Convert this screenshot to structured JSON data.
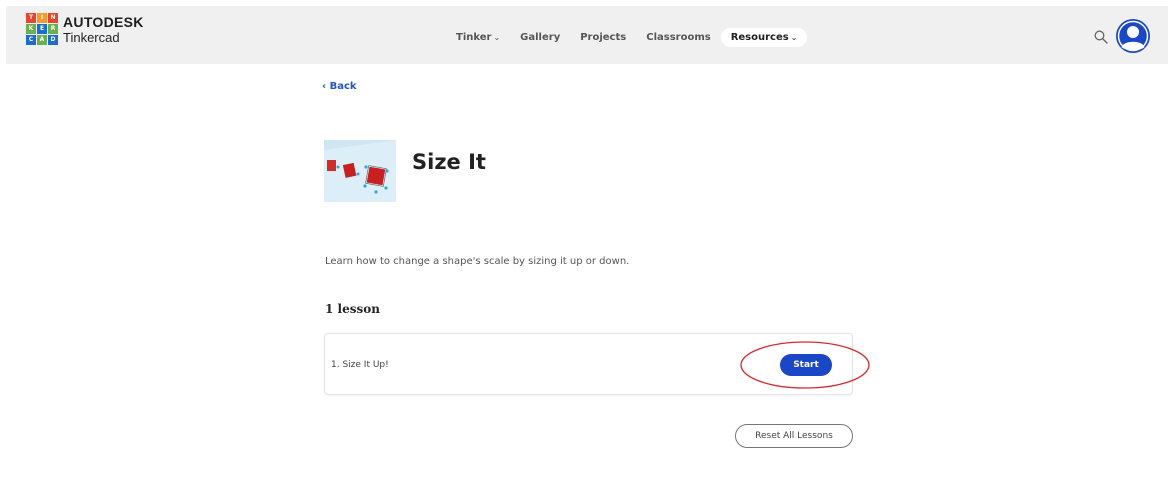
{
  "header": {
    "logo": {
      "brand": "AUTODESK",
      "product": "Tinkercad",
      "tiles": [
        {
          "letter": "T",
          "color": "#e8452c"
        },
        {
          "letter": "I",
          "color": "#f79a2c"
        },
        {
          "letter": "N",
          "color": "#e8452c"
        },
        {
          "letter": "K",
          "color": "#6ab04c"
        },
        {
          "letter": "E",
          "color": "#1a6ecf"
        },
        {
          "letter": "R",
          "color": "#6ab04c"
        },
        {
          "letter": "C",
          "color": "#1a6ecf"
        },
        {
          "letter": "A",
          "color": "#6ab04c"
        },
        {
          "letter": "D",
          "color": "#1a6ecf"
        }
      ]
    },
    "nav": [
      {
        "label": "Tinker",
        "has_dropdown": true,
        "active": false
      },
      {
        "label": "Gallery",
        "has_dropdown": false,
        "active": false
      },
      {
        "label": "Projects",
        "has_dropdown": false,
        "active": false
      },
      {
        "label": "Classrooms",
        "has_dropdown": false,
        "active": false
      },
      {
        "label": "Resources",
        "has_dropdown": true,
        "active": true
      }
    ],
    "icons": {
      "search": "search-icon",
      "avatar": "user-avatar-icon"
    },
    "avatar_color": "#1a47c7"
  },
  "main": {
    "back_label": "‹ Back",
    "title": "Size It",
    "description": "Learn how to change a shape's scale by sizing it up or down.",
    "lesson_count": "1 lesson",
    "lessons": [
      {
        "title": "1. Size It Up!",
        "action_label": "Start"
      }
    ],
    "reset_label": "Reset All Lessons"
  },
  "colors": {
    "accent": "#1a47c7",
    "link": "#1f55c2",
    "annotation": "#d9262b",
    "header_bg": "#f0f0f0"
  }
}
